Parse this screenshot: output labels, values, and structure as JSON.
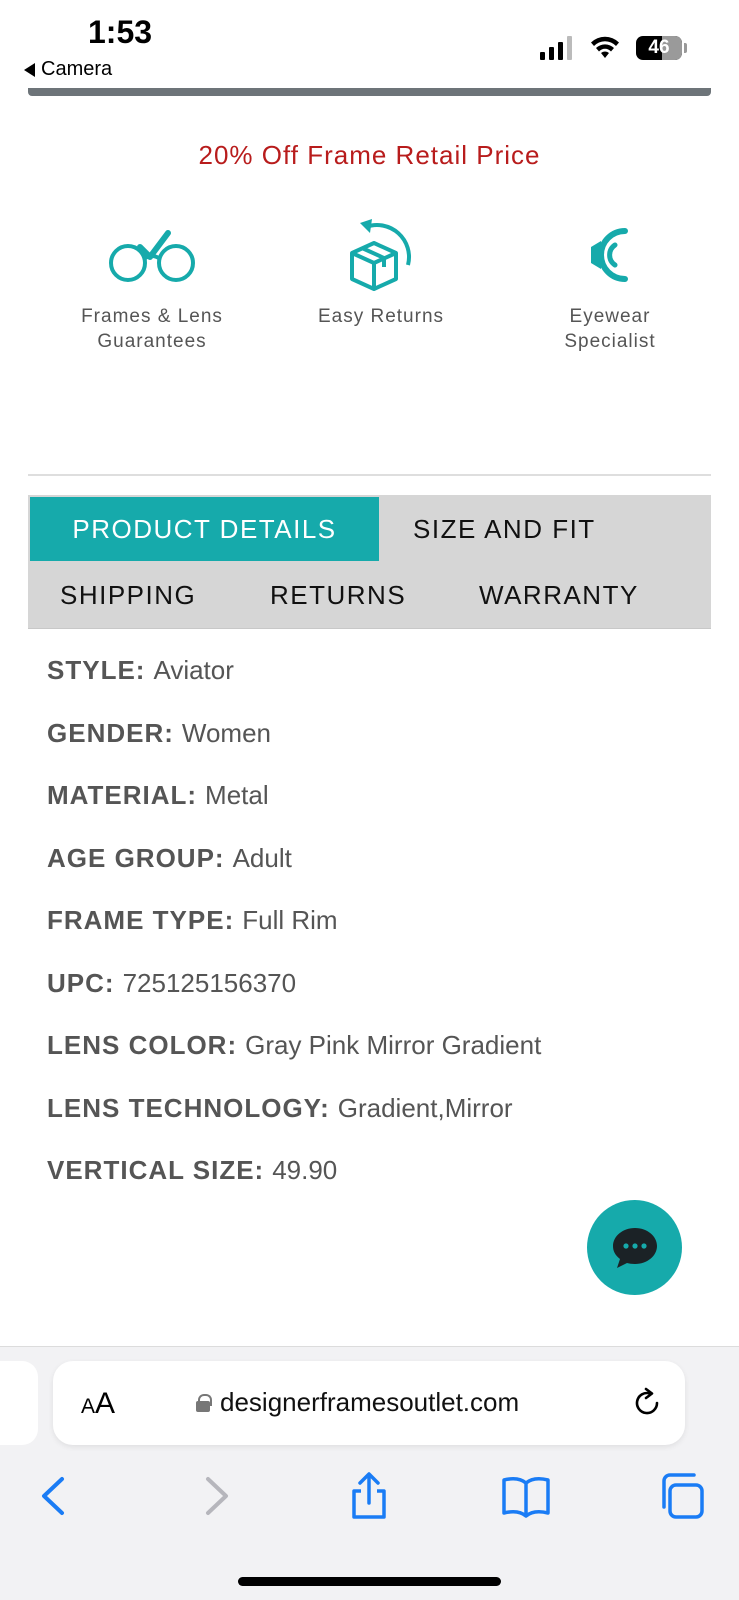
{
  "status": {
    "time": "1:53",
    "back_app": "Camera",
    "battery": "46"
  },
  "promo": {
    "text": "20% Off Frame Retail Price"
  },
  "features": [
    {
      "icon": "glasses-check-icon",
      "line1": "Frames & Lens",
      "line2": "Guarantees"
    },
    {
      "icon": "box-return-icon",
      "line1": "Easy Returns",
      "line2": ""
    },
    {
      "icon": "specialist-icon",
      "line1": "Eyewear",
      "line2": "Specialist"
    }
  ],
  "tabs": [
    {
      "label": "PRODUCT DETAILS",
      "active": true
    },
    {
      "label": "SIZE AND FIT",
      "active": false
    },
    {
      "label": "SHIPPING",
      "active": false
    },
    {
      "label": "RETURNS",
      "active": false
    },
    {
      "label": "WARRANTY",
      "active": false
    }
  ],
  "details": [
    {
      "key": "STYLE:",
      "value": "Aviator"
    },
    {
      "key": "GENDER:",
      "value": "Women"
    },
    {
      "key": "MATERIAL:",
      "value": "Metal"
    },
    {
      "key": "AGE GROUP:",
      "value": "Adult"
    },
    {
      "key": "FRAME TYPE:",
      "value": "Full Rim"
    },
    {
      "key": "UPC:",
      "value": "725125156370"
    },
    {
      "key": "LENS COLOR:",
      "value": "Gray Pink Mirror Gradient"
    },
    {
      "key": "LENS TECHNOLOGY:",
      "value": "Gradient,Mirror"
    },
    {
      "key": "VERTICAL SIZE:",
      "value": "49.90"
    }
  ],
  "browser": {
    "aa_small": "A",
    "aa_large": "A",
    "url": "designerframesoutlet.com"
  },
  "colors": {
    "accent": "#16aaab",
    "promo": "#b81c1c",
    "ios_blue": "#1a7cf5"
  }
}
